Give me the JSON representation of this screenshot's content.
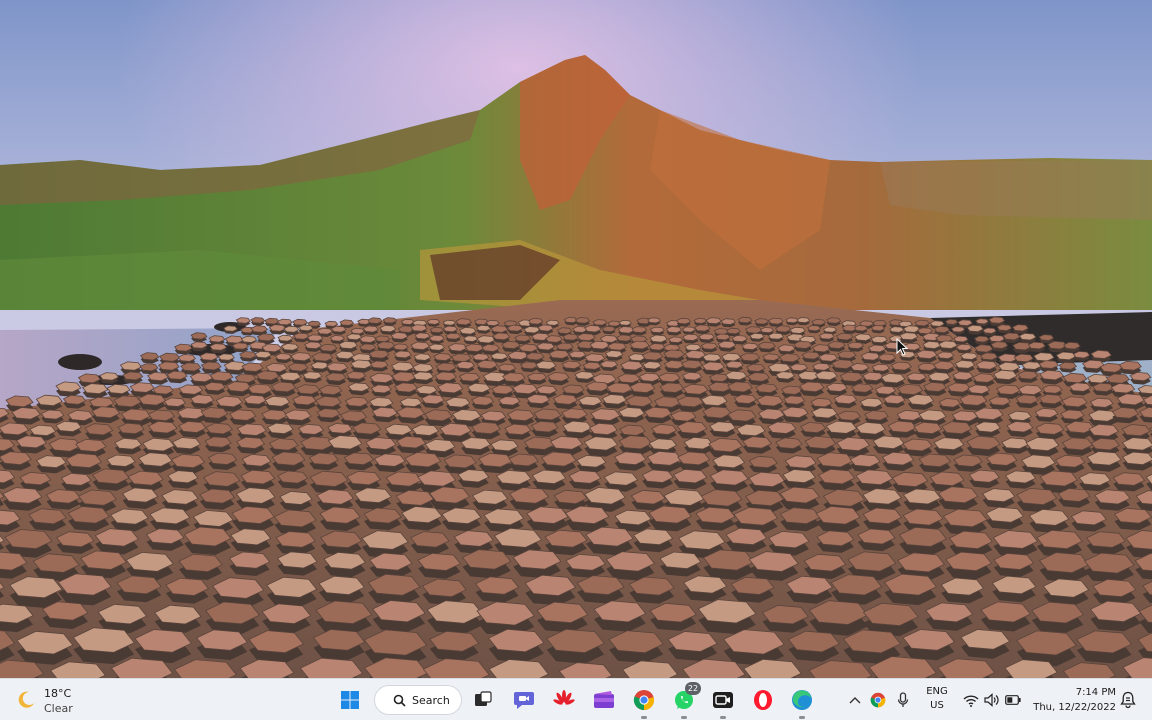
{
  "taskbar": {
    "weather": {
      "temperature": "18°C",
      "condition": "Clear",
      "icon": "moon-icon"
    },
    "start_icon": "windows-start-icon",
    "search_label": "Search",
    "apps": [
      {
        "name": "task-view",
        "icon": "task-view-icon"
      },
      {
        "name": "teams-chat",
        "icon": "teams-chat-icon"
      },
      {
        "name": "huawei",
        "icon": "huawei-icon"
      },
      {
        "name": "clipchamp",
        "icon": "clipchamp-icon"
      },
      {
        "name": "chrome",
        "icon": "chrome-icon"
      },
      {
        "name": "whatsapp",
        "icon": "whatsapp-icon",
        "badge": "22"
      },
      {
        "name": "camera",
        "icon": "camera-icon"
      },
      {
        "name": "opera",
        "icon": "opera-icon"
      },
      {
        "name": "edge",
        "icon": "edge-icon"
      }
    ],
    "tray": {
      "chevron_icon": "chevron-up-icon",
      "language_line1": "ENG",
      "language_line2": "US",
      "time": "7:14 PM",
      "date": "Thu, 12/22/2022"
    }
  },
  "desktop": {
    "wallpaper": "Giant's Causeway basalt columns at sunset"
  }
}
